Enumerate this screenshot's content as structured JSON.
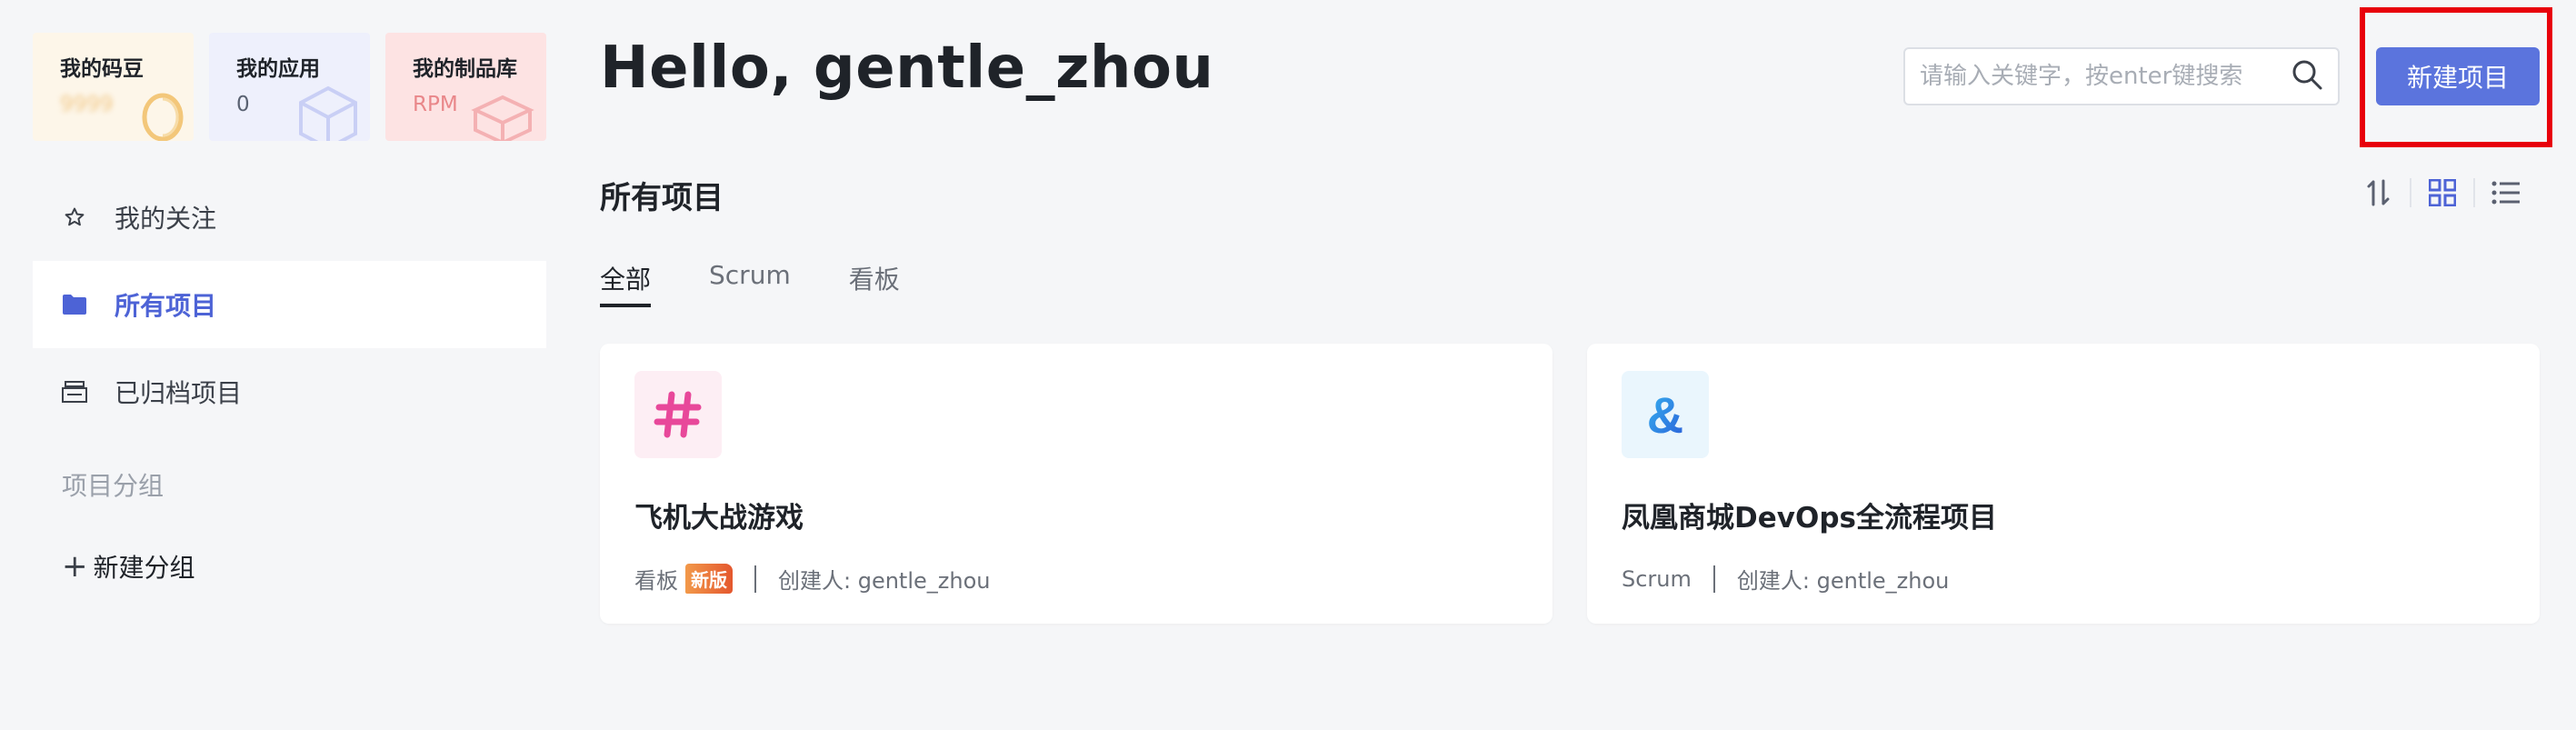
{
  "stats": {
    "beans": {
      "title": "我的码豆",
      "value": "9999"
    },
    "apps": {
      "title": "我的应用",
      "value": "0"
    },
    "library": {
      "title": "我的制品库",
      "value": "RPM"
    }
  },
  "nav": {
    "follow": "我的关注",
    "all_projects": "所有项目",
    "archived": "已归档项目",
    "group_title": "项目分组",
    "add_group": "新建分组"
  },
  "header": {
    "greeting": "Hello, gentle_zhou",
    "search_placeholder": "请输入关键字，按enter键搜索",
    "new_project": "新建项目"
  },
  "section": {
    "title": "所有项目"
  },
  "tabs": [
    "全部",
    "Scrum",
    "看板"
  ],
  "projects": [
    {
      "name": "飞机大战游戏",
      "type": "看板",
      "badge": "新版",
      "creator": "创建人: gentle_zhou",
      "icon": "hash-icon",
      "icon_color": "#e8489a"
    },
    {
      "name": "凤凰商城DevOps全流程项目",
      "type": "Scrum",
      "creator": "创建人: gentle_zhou",
      "icon": "ampersand-icon",
      "icon_color": "#2f7de1"
    }
  ],
  "colors": {
    "accent": "#5b74dd",
    "active_nav": "#4d63d6",
    "highlight_frame": "#e8000b",
    "background": "#f5f6f8"
  }
}
